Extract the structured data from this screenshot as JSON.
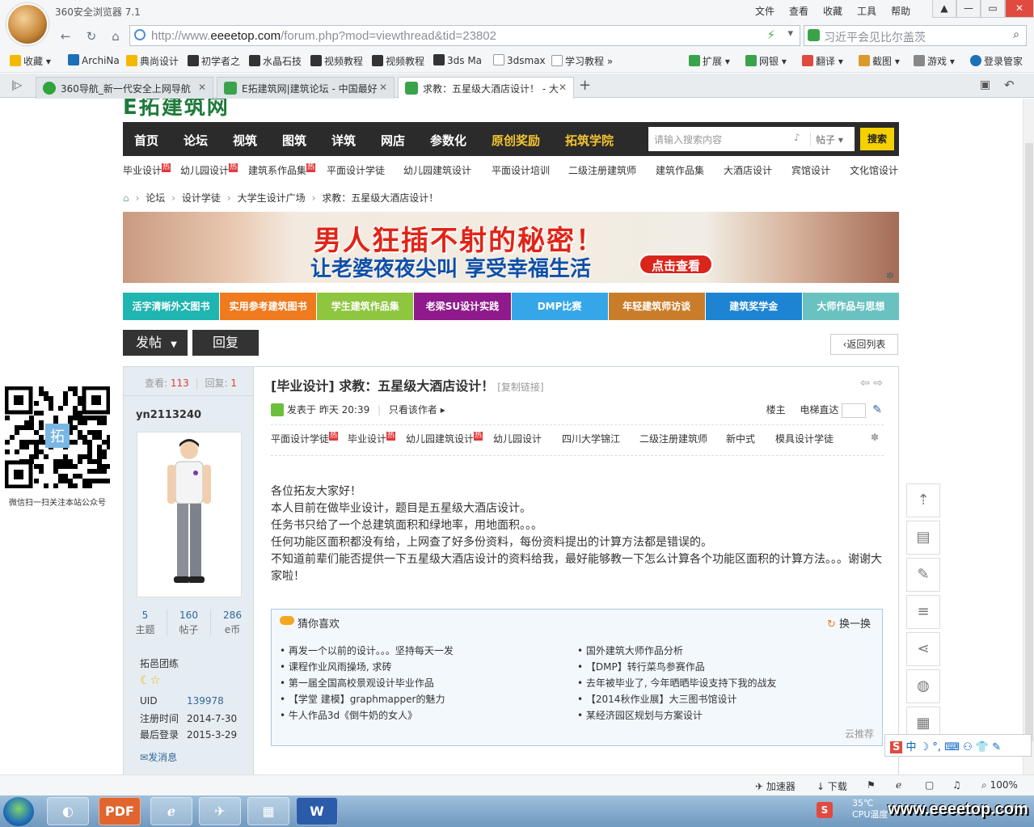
{
  "browser": {
    "app_title": "360安全浏览器 7.1",
    "menu": [
      "文件",
      "查看",
      "收藏",
      "工具",
      "帮助"
    ],
    "url_prefix": "http://www.",
    "url_domain": "eeeetop.com",
    "url_path": "/forum.php?mod=viewthread&tid=23802",
    "search_text": "习近平会见比尔盖茨",
    "bookmarks": [
      "收藏",
      "ArchiNa",
      "典尚设计",
      "初学者之",
      "水晶石技",
      "视频教程",
      "视频教程",
      "3ds Ma",
      "3dsmax",
      "学习教程"
    ],
    "right_tools": [
      "扩展",
      "网银",
      "翻译",
      "截图",
      "游戏",
      "登录管家"
    ],
    "tabs": [
      {
        "label": "360导航_新一代安全上网导航"
      },
      {
        "label": "E拓建筑网|建筑论坛 - 中国最好"
      },
      {
        "label": "求教：五星级大酒店设计！ - 大"
      }
    ]
  },
  "site": {
    "logo_text": "E拓建筑网",
    "main_nav": [
      "首页",
      "论坛",
      "视筑",
      "图筑",
      "详筑",
      "网店",
      "参数化",
      "原创奖励",
      "拓筑学院"
    ],
    "search_placeholder": "请输入搜索内容",
    "search_scope": "帖子",
    "search_button": "搜索",
    "sub_nav": [
      "毕业设计",
      "幼儿园设计",
      "建筑系作品集",
      "平面设计学徒",
      "幼儿园建筑设计",
      "平面设计培训",
      "二级注册建筑师",
      "建筑作品集",
      "大酒店设计",
      "宾馆设计",
      "文化馆设计"
    ],
    "hot_label": "热",
    "breadcrumb": [
      "论坛",
      "设计学徒",
      "大学生设计广场",
      "求教：五星级大酒店设计！"
    ],
    "ad_line1": "男人狂插不射的秘密！",
    "ad_line2": "让老婆夜夜尖叫 享受幸福生活",
    "ad_cta": "点击查看",
    "categories": [
      {
        "label": "活字清晰外文图书",
        "color": "#1fb5b0"
      },
      {
        "label": "实用参考建筑图书",
        "color": "#f07a1e"
      },
      {
        "label": "学生建筑作品集",
        "color": "#8ec63f"
      },
      {
        "label": "老梁SU设计实践",
        "color": "#8e1a8c"
      },
      {
        "label": "DMP比赛",
        "color": "#35a7e8"
      },
      {
        "label": "年轻建筑师访谈",
        "color": "#c97d2a"
      },
      {
        "label": "建筑奖学金",
        "color": "#1d84d4"
      },
      {
        "label": "大师作品与思想",
        "color": "#6ac2c0"
      }
    ],
    "post_button": "发帖",
    "reply_button": "回复",
    "back_button": "返回列表",
    "qr_label": "微信扫一扫关注本站公众号"
  },
  "thread": {
    "views_label": "查看:",
    "views": "113",
    "replies_label": "回复:",
    "replies": "1",
    "title": "[毕业设计] 求教：五星级大酒店设计！",
    "copy_link": "[复制链接]",
    "posted": "发表于 昨天 20:39",
    "author_only": "只看该作者",
    "floor": "楼主",
    "elevator": "电梯直达",
    "tags": [
      "平面设计学徒",
      "毕业设计",
      "幼儿园建筑设计",
      "幼儿园设计",
      "四川大学锦江",
      "二级注册建筑师",
      "新中式",
      "模具设计学徒"
    ],
    "body": [
      "各位拓友大家好！",
      "本人目前在做毕业设计，题目是五星级大酒店设计。",
      "任务书只给了一个总建筑面积和绿地率，用地面积。。。",
      "任何功能区面积都没有给，上网查了好多份资料，每份资料提出的计算方法都是错误的。",
      "不知道前辈们能否提供一下五星级大酒店设计的资料给我，最好能够教一下怎么计算各个功能区面积的计算方法。。。谢谢大家啦！"
    ]
  },
  "author": {
    "name": "yn2113240",
    "stats": [
      {
        "value": "5",
        "label": "主题"
      },
      {
        "value": "160",
        "label": "帖子"
      },
      {
        "value": "286",
        "label": "e币"
      }
    ],
    "group": "拓邑团练",
    "uid_label": "UID",
    "uid": "139978",
    "reg_label": "注册时间",
    "reg": "2014-7-30",
    "last_label": "最后登录",
    "last": "2015-3-29",
    "message": "发消息"
  },
  "recommend": {
    "title": "猜你喜欢",
    "refresh": "换一换",
    "left": [
      "再发一个以前的设计。。。坚持每天一发",
      "课程作业风雨操场, 求砖",
      "第一届全国高校景观设计毕业作品",
      "【学堂 建模】graphmapper的魅力",
      "牛人作品3d《倒牛奶的女人》"
    ],
    "right": [
      "国外建筑大师作品分析",
      "【DMP】转行菜鸟参赛作品",
      "去年被毕业了, 今年晒晒毕设支持下我的战友",
      "【2014秋作业展】大三图书馆设计",
      "某经济园区规划与方案设计"
    ],
    "footer": "云推荐"
  },
  "statusbar": {
    "accelerator": "加速器",
    "download": "下载",
    "zoom": "100%"
  },
  "taskbar": {
    "temp": "35℃",
    "cpu": "CPU温度",
    "watermark": "www.eeeetop.com"
  }
}
